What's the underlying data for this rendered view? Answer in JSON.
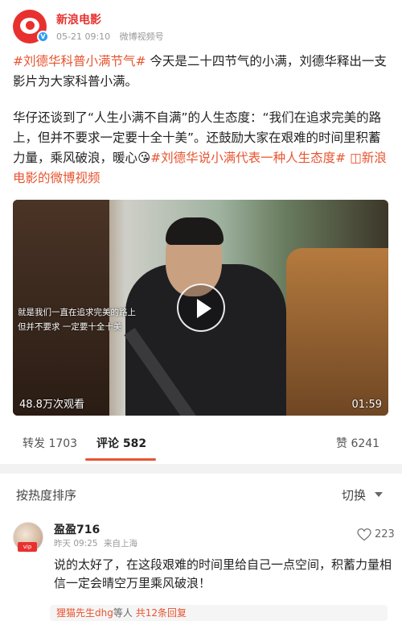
{
  "post": {
    "author": "新浪电影",
    "date": "05-21 09:10",
    "source": "微博视频号",
    "paragraph1": {
      "tag": "#刘德华科普小满节气#",
      "text": "今天是二十四节气的小满，刘德华释出一支影片为大家科普小满。"
    },
    "paragraph2": {
      "text": "华仔还谈到了“人生小满不自满”的人生态度：“我们在追求完美的路上，但并不要求一定要十全十美”。还鼓励大家在艰难的时间里积蓄力量，乘风破浪，暖心😘",
      "tag": "#刘德华说小满代表一种人生态度#",
      "link": "新浪电影的微博视频"
    }
  },
  "video": {
    "subtitle_line1": "就是我们一直在追求完美的路上",
    "subtitle_line2": "但并不要求  一定要十全十美",
    "views": "48.8万次观看",
    "duration": "01:59"
  },
  "stats": {
    "repost": "转发 1703",
    "comments": "评论 582",
    "likes": "赞 6241"
  },
  "sort": {
    "label": "按热度排序",
    "toggle": "切换"
  },
  "comment": {
    "user": "盈盈716",
    "time": "昨天 09:25",
    "location": "来自上海",
    "likes": "223",
    "text": "说的太好了，在这段艰难的时间里给自己一点空间，积蓄力量相信一定会晴空万里乘风破浪！",
    "reply_user": "狸猫先生dhg",
    "reply_suffix": "等人",
    "reply_count": "共12条回复"
  },
  "colors": {
    "brand_red": "#e8312f",
    "tag_orange": "#e8542f",
    "verified_blue": "#2d9cf4"
  }
}
